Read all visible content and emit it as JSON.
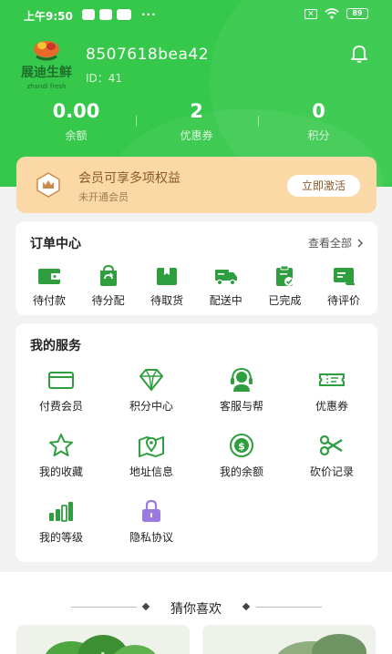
{
  "status_bar": {
    "time": "上午9:50",
    "more": "···",
    "battery": "89"
  },
  "profile": {
    "username": "8507618bea42",
    "user_id": "ID：41",
    "logo_text": "展迪生鲜"
  },
  "stats": [
    {
      "value": "0.00",
      "label": "余额"
    },
    {
      "value": "2",
      "label": "优惠券"
    },
    {
      "value": "0",
      "label": "积分"
    }
  ],
  "member": {
    "title": "会员可享多项权益",
    "subtitle": "未开通会员",
    "button": "立即激活"
  },
  "orders": {
    "title": "订单中心",
    "view_all": "查看全部",
    "items": [
      {
        "label": "待付款",
        "icon": "wallet-icon"
      },
      {
        "label": "待分配",
        "icon": "refresh-bag-icon"
      },
      {
        "label": "待取货",
        "icon": "box-icon"
      },
      {
        "label": "配送中",
        "icon": "truck-icon"
      },
      {
        "label": "已完成",
        "icon": "clipboard-check-icon"
      },
      {
        "label": "待评价",
        "icon": "review-icon"
      }
    ]
  },
  "services": {
    "title": "我的服务",
    "items": [
      {
        "label": "付费会员",
        "icon": "card-icon"
      },
      {
        "label": "积分中心",
        "icon": "diamond-icon"
      },
      {
        "label": "客服与帮",
        "icon": "headset-icon"
      },
      {
        "label": "优惠券",
        "icon": "ticket-icon"
      },
      {
        "label": "我的收藏",
        "icon": "star-icon"
      },
      {
        "label": "地址信息",
        "icon": "map-pin-icon"
      },
      {
        "label": "我的余额",
        "icon": "dollar-coin-icon"
      },
      {
        "label": "砍价记录",
        "icon": "scissors-icon"
      },
      {
        "label": "我的等级",
        "icon": "bar-chart-icon"
      },
      {
        "label": "隐私协议",
        "icon": "lock-icon"
      }
    ]
  },
  "guess": {
    "title": "猜你喜欢"
  },
  "colors": {
    "primary": "#35c84a",
    "icon_green": "#2f9e3e",
    "member_bg": "#fbd9a6",
    "lock_purple": "#9b7be0"
  }
}
